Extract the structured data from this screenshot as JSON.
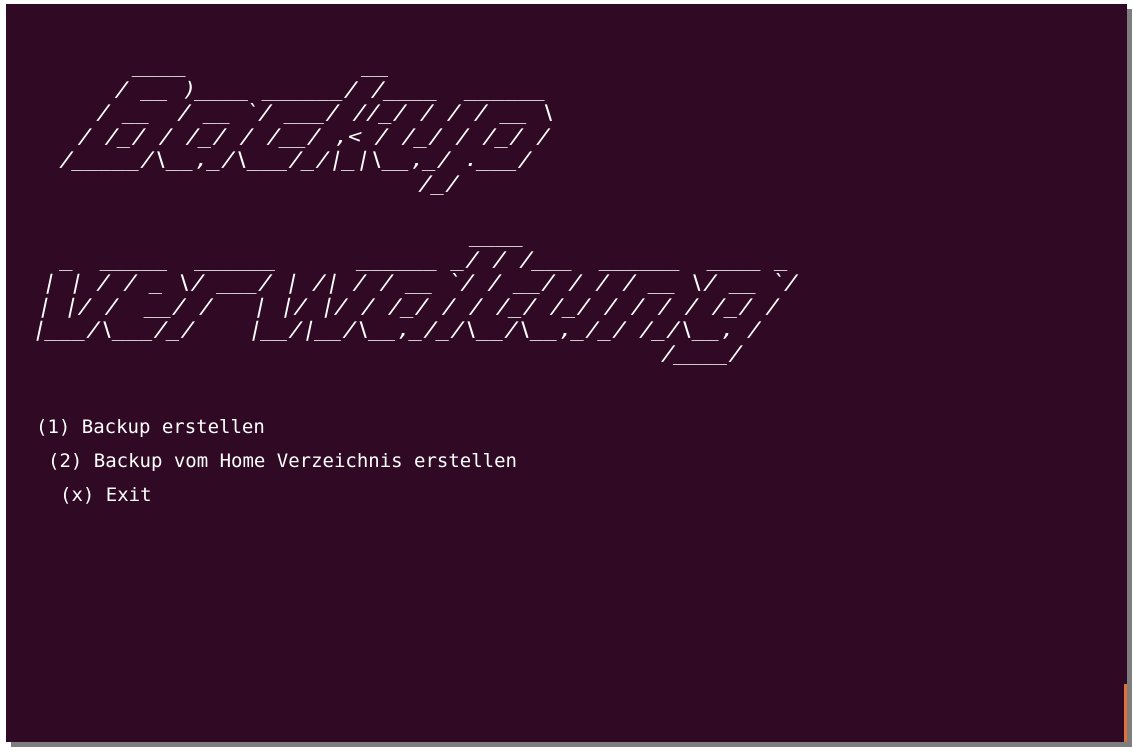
{
  "terminal": {
    "banner_line_1": [
      "       ____             __",
      "      / __ )____ ______/ /____  ______",
      "     / __  / __ `/ ___/ //_/ / / / __ \\",
      "    / /_/ / /_/ / /__/ ,< / /_/ / /_/ /",
      "   /_____/\\__,_/\\___/_/|_|\\__,_/ .___/",
      "                              /_/"
    ],
    "banner_line_2": [
      "                                ____",
      "  _  _____  ______      ______ _/ / /___  ______  ____ _",
      " | | / / _ \\/ ___/ | /| / / __ `/ / __/ / / / __ \\/ __ `/",
      " | |/ /  __/ /   | |/ |/ / /_/ / / /_/ /_/ / / / / /_/ /",
      " |___/\\___/_/    |__/|__/\\__,_/_/\\__/\\__,_/_/ /_/\\__, /",
      "                                                /____/"
    ],
    "menu": {
      "option_1": "(1) Backup erstellen",
      "option_2": "(2) Backup vom Home Verzeichnis erstellen",
      "option_x": "(x) Exit"
    },
    "colors": {
      "background": "#300a24",
      "text": "#ffffff",
      "cursor": "#e0703a"
    }
  }
}
